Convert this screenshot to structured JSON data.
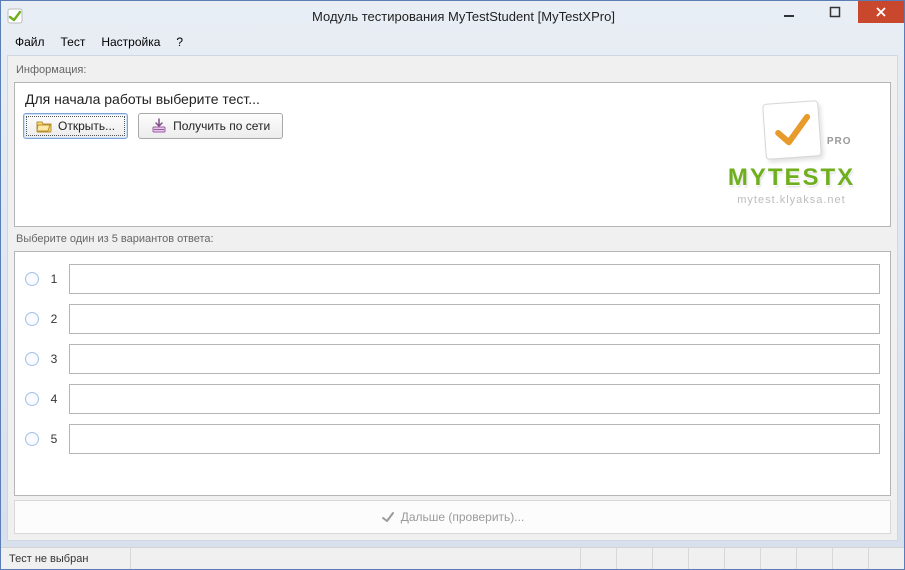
{
  "window": {
    "title": "Модуль тестирования MyTestStudent [MyTestXPro]"
  },
  "menubar": {
    "items": [
      "Файл",
      "Тест",
      "Настройка",
      "?"
    ]
  },
  "info": {
    "group_label": "Информация:",
    "prompt": "Для начала работы выберите тест...",
    "open_btn": "Открыть...",
    "network_btn": "Получить по сети"
  },
  "logo": {
    "brand": "MYTESTX",
    "pro_tag": "PRO",
    "url": "mytest.klyaksa.net"
  },
  "answers": {
    "group_label": "Выберите один из 5 вариантов ответа:",
    "options": [
      {
        "num": "1",
        "text": ""
      },
      {
        "num": "2",
        "text": ""
      },
      {
        "num": "3",
        "text": ""
      },
      {
        "num": "4",
        "text": ""
      },
      {
        "num": "5",
        "text": ""
      }
    ]
  },
  "next_button": "Дальше (проверить)...",
  "statusbar": {
    "text": "Тест не выбран"
  }
}
